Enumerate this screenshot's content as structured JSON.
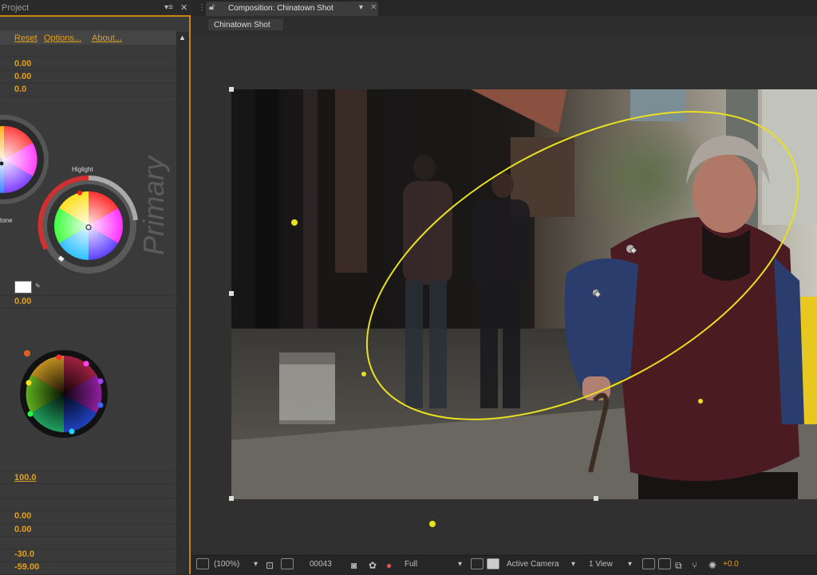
{
  "left_panel": {
    "tab_title": "Project",
    "toolbar": {
      "reset": "Reset",
      "options": "Options...",
      "about": "About..."
    },
    "values_top": [
      "0.00",
      "0.00",
      "0.0"
    ],
    "labels": {
      "highlight": "Higlight",
      "midtone": "tone",
      "primary": "Primary"
    },
    "swatch_value": "0.00",
    "values_bottom": [
      "100.0",
      "0.00",
      "0.00",
      "-30.0",
      "-59.00"
    ]
  },
  "composition": {
    "tab_label": "Composition: Chinatown Shot",
    "sub_tab": "Chinatown Shot"
  },
  "bottom_bar": {
    "zoom": "(100%)",
    "timecode": "00043",
    "resolution": "Full",
    "camera": "Active Camera",
    "views": "1 View",
    "exposure": "+0.0"
  },
  "colors": {
    "accent": "#e0a020",
    "mask": "#e8e020",
    "panel_border": "#c8860a"
  }
}
